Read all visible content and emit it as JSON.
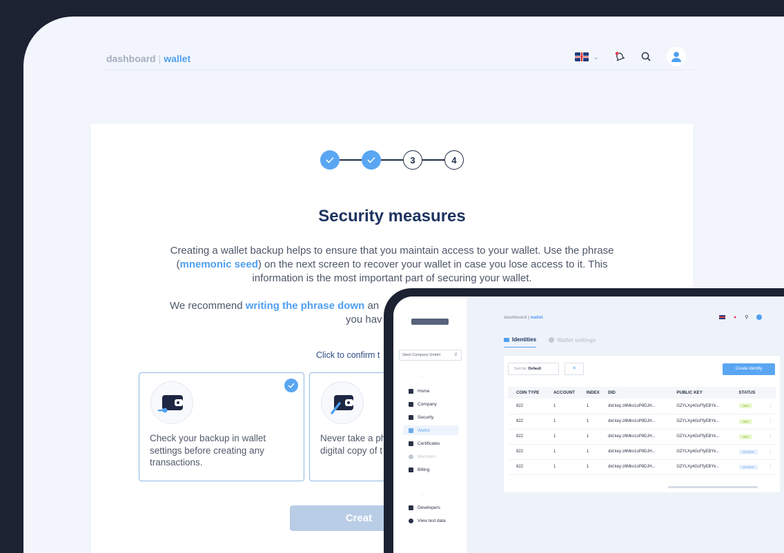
{
  "back": {
    "breadcrumb": {
      "parent": "dashboard",
      "separator": "|",
      "current": "wallet"
    },
    "header_icons": [
      "flag-uk-icon",
      "chevron-down-icon",
      "bell-icon",
      "search-icon",
      "user-icon"
    ],
    "stepper": [
      {
        "state": "done",
        "label": ""
      },
      {
        "state": "done",
        "label": ""
      },
      {
        "state": "todo",
        "label": "3"
      },
      {
        "state": "todo",
        "label": "4"
      }
    ],
    "title": "Security measures",
    "para1": {
      "a": "Creating a wallet backup helps to ensure that you maintain access to your wallet. Use the phrase (",
      "link": "mnemonic seed",
      "b": ") on the next screen to recover your wallet in case you lose access to it. This information is the most important part of securing your wallet."
    },
    "para2": {
      "a": "We recommend ",
      "link": "writing the phrase down",
      "b": " an",
      "line2": "you hav"
    },
    "confirm_hint": "Click to confirm t",
    "options": [
      {
        "text": "Check your backup in wallet\nsettings before creating any\ntransactions.",
        "checked": true,
        "icon": "wallet-key-icon"
      },
      {
        "text": "Never take a ph\ndigital copy of t",
        "checked": false,
        "icon": "wallet-pen-icon"
      }
    ],
    "create_button": "Creat"
  },
  "front": {
    "breadcrumb": {
      "parent": "dashboard",
      "separator": "|",
      "current": "wallet"
    },
    "company": "Steel Company GmbH",
    "nav": [
      {
        "label": "Home",
        "icon": "home-icon",
        "state": "normal"
      },
      {
        "label": "Company",
        "icon": "company-icon",
        "state": "normal"
      },
      {
        "label": "Security",
        "icon": "shield-icon",
        "state": "normal"
      },
      {
        "label": "Wallet",
        "icon": "wallet-icon",
        "state": "active"
      },
      {
        "label": "Certificates",
        "icon": "certificate-icon",
        "state": "normal"
      },
      {
        "label": "Members",
        "icon": "members-icon",
        "state": "muted"
      },
      {
        "label": "Billing",
        "icon": "card-icon",
        "state": "normal"
      }
    ],
    "nav_bottom": [
      {
        "label": "Developers",
        "icon": "code-icon"
      },
      {
        "label": "View test data",
        "icon": "toggle-icon"
      }
    ],
    "tabs": [
      {
        "label": "Identities",
        "active": true
      },
      {
        "label": "Wallet settings",
        "active": false
      }
    ],
    "sort": {
      "prefix": "Sort by:",
      "value": "Default"
    },
    "create_identity": "Create identity",
    "table": {
      "headers": [
        "COIN TYPE",
        "ACCOUNT",
        "INDEX",
        "DID",
        "PUBLIC KEY",
        "STATUS"
      ],
      "rows": [
        [
          "822",
          "1",
          "1",
          "did:key:z6Mkv1oP8DJH...",
          "GZYLXy4GcFfyEBYk...",
          "valid"
        ],
        [
          "822",
          "1",
          "1",
          "did:key:z6Mkv1oP8DJH...",
          "GZYLXy4GcFfyEBYk...",
          "valid"
        ],
        [
          "822",
          "1",
          "1",
          "did:key:z6Mkv1oP8DJH...",
          "GZYLXy4GcFfyEBYk...",
          "valid"
        ],
        [
          "822",
          "1",
          "1",
          "did:key:z6Mkv1oP8DJH...",
          "GZYLXy4GcFfyEBYk...",
          "obsolete"
        ],
        [
          "822",
          "1",
          "1",
          "did:key:z6Mkv1oP8DJH...",
          "GZYLXy4GcFfyEBYk...",
          "obsolete"
        ]
      ]
    },
    "colors": {
      "accent": "#5aa6f2",
      "navy": "#1d3460",
      "valid": "#8bbb33",
      "obsolete": "#7aa8e4"
    }
  }
}
